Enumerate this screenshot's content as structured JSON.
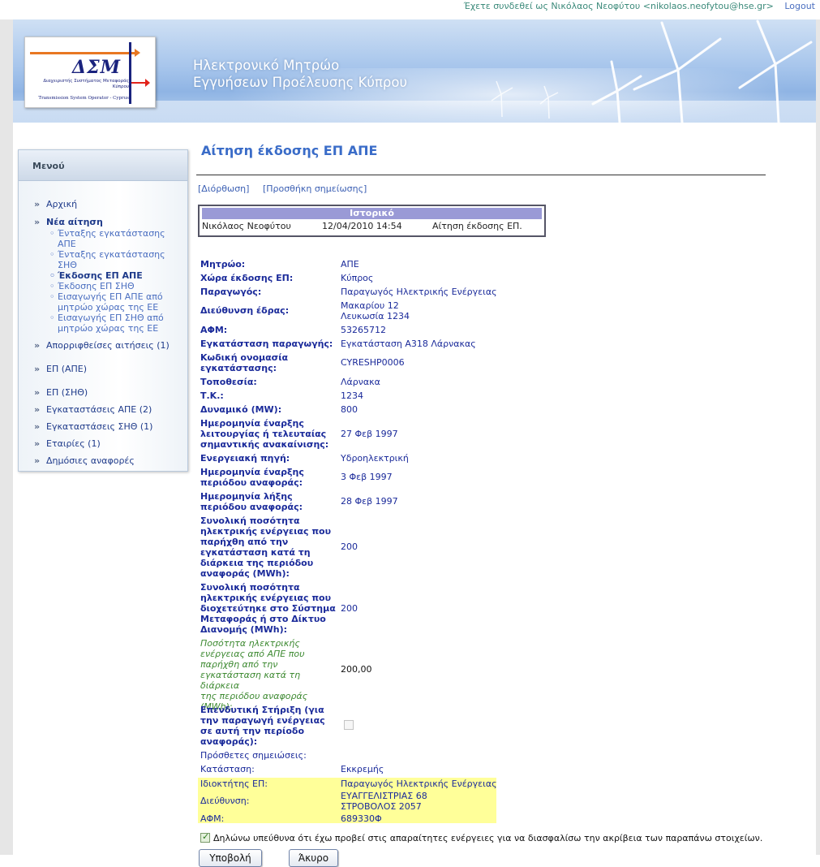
{
  "topbar": {
    "login_text": "Έχετε συνδεθεί ως Νικόλαος Νεοφύτου <nikolaos.neofytou@hse.gr>",
    "logout_label": "Logout"
  },
  "header": {
    "logo_mark": "ΔΣΜ",
    "logo_sub1": "Διαχειριστής Συστήματος Μεταφοράς Κύπρου",
    "logo_sub2": "Transmission System Operator - Cyprus",
    "title_line1": "Ηλεκτρονικό Μητρώο",
    "title_line2": "Εγγυήσεων Προέλευσης Κύπρου"
  },
  "sidebar": {
    "title": "Μενού",
    "items": [
      {
        "label": "Αρχική"
      },
      {
        "label": "Νέα αίτηση"
      },
      {
        "label": "Απορριφθείσες αιτήσεις (1)"
      },
      {
        "label": "ΕΠ (ΑΠΕ)"
      },
      {
        "label": "ΕΠ (ΣΗΘ)"
      },
      {
        "label": "Εγκαταστάσεις ΑΠΕ (2)"
      },
      {
        "label": "Εγκαταστάσεις ΣΗΘ (1)"
      },
      {
        "label": "Εταιρίες (1)"
      },
      {
        "label": "Δημόσιες αναφορές"
      }
    ],
    "subitems": [
      {
        "label_l1": "Ένταξης εγκατάστασης",
        "label_l2": "ΑΠΕ"
      },
      {
        "label_l1": "Ένταξης εγκατάστασης",
        "label_l2": "ΣΗΘ"
      },
      {
        "label_l1": "Έκδοσης ΕΠ ΑΠΕ"
      },
      {
        "label_l1": "Έκδοσης ΕΠ ΣΗΘ"
      },
      {
        "label_l1": "Εισαγωγής ΕΠ ΑΠΕ από",
        "label_l2": "μητρώο χώρας της ΕΕ"
      },
      {
        "label_l1": "Εισαγωγής ΕΠ ΣΗΘ από",
        "label_l2": "μητρώο χώρας της ΕΕ"
      }
    ]
  },
  "main": {
    "page_title": "Αίτηση έκδοσης ΕΠ ΑΠΕ",
    "actions": {
      "edit": "[Διόρθωση]",
      "add_note": "[Προσθήκη σημείωσης]"
    },
    "history": {
      "title": "Ιστορικό",
      "user": "Νικόλαος Νεοφύτου",
      "datetime": "12/04/2010 14:54",
      "action": "Αίτηση έκδοσης ΕΠ."
    },
    "fields": {
      "registry": {
        "label": "Μητρώο:",
        "value": "ΑΠΕ"
      },
      "country": {
        "label": "Χώρα έκδοσης ΕΠ:",
        "value": "Κύπρος"
      },
      "producer": {
        "label": "Παραγωγός:",
        "value": "Παραγωγός Ηλεκτρικής Ενέργειας"
      },
      "address": {
        "label": "Διεύθυνση έδρας:",
        "value_l1": "Μακαρίου 12",
        "value_l2": "Λευκωσία 1234"
      },
      "afm": {
        "label": "ΑΦΜ:",
        "value": "53265712"
      },
      "installation": {
        "label": "Εγκατάσταση παραγωγής:",
        "value": "Εγκατάσταση Α318 Λάρνακας"
      },
      "code": {
        "label_l1": "Κωδική ονομασία",
        "label_l2": "εγκατάστασης:",
        "value": "CYRESHP0006"
      },
      "location": {
        "label": "Τοποθεσία:",
        "value": "Λάρνακα"
      },
      "postcode": {
        "label": "Τ.Κ.:",
        "value": "1234"
      },
      "capacity": {
        "label": "Δυναμικό (MW):",
        "value": "800"
      },
      "start_date": {
        "label_l1": "Ημερομηνία έναρξης",
        "label_l2": "λειτουργίας ή τελευταίας",
        "label_l3": "σημαντικής ανακαίνισης:",
        "value": "27 Φεβ 1997"
      },
      "energy_source": {
        "label": "Ενεργειακή πηγή:",
        "value": "Υδροηλεκτρική"
      },
      "period_start": {
        "label_l1": "Ημερομηνία έναρξης",
        "label_l2": "περιόδου αναφοράς:",
        "value": "3 Φεβ 1997"
      },
      "period_end": {
        "label_l1": "Ημερομηνία λήξης",
        "label_l2": "περιόδου αναφοράς:",
        "value": "28 Φεβ 1997"
      },
      "total_produced": {
        "label_l1": "Συνολική ποσότητα",
        "label_l2": "ηλεκτρικής ενέργειας που",
        "label_l3": "παρήχθη από την",
        "label_l4": "εγκατάσταση κατά τη",
        "label_l5": "διάρκεια της περιόδου",
        "label_l6": "αναφοράς (MWh):",
        "value": "200"
      },
      "total_injected": {
        "label_l1": "Συνολική ποσότητα",
        "label_l2": "ηλεκτρικής ενέργειας που",
        "label_l3": "διοχετεύτηκε στο Σύστημα",
        "label_l4": "Μεταφοράς ή στο Δίκτυο",
        "label_l5": "Διανομής (MWh):",
        "value": "200"
      },
      "res_quantity": {
        "label_l1": "Ποσότητα ηλεκτρικής",
        "label_l2": "ενέργειας από ΑΠΕ που",
        "label_l3": "παρήχθη από την",
        "label_l4": "εγκατάσταση κατά τη διάρκεια",
        "label_l5": "της περιόδου αναφοράς",
        "label_l6": "(MWh):",
        "value": "200,00"
      },
      "investment_support": {
        "label_l1": "Επενδυτική Στήριξη (για",
        "label_l2": "την παραγωγή ενέργειας",
        "label_l3": "σε αυτή την περίοδο",
        "label_l4": "αναφοράς):"
      },
      "notes": {
        "label": "Πρόσθετες σημειώσεις:"
      },
      "status": {
        "label": "Κατάσταση:",
        "value": "Εκκρεμής"
      },
      "owner": {
        "label": "Ιδιοκτήτης ΕΠ:",
        "value": "Παραγωγός Ηλεκτρικής Ενέργειας"
      },
      "owner_address": {
        "label": "Διεύθυνση:",
        "value_l1": "ΕΥΑΓΓΕΛΙΣΤΡΙΑΣ 68",
        "value_l2": "ΣΤΡΟΒΟΛΟΣ 2057"
      },
      "owner_afm": {
        "label": "ΑΦΜ:",
        "value": "689330Φ"
      }
    },
    "declaration": "Δηλώνω υπεύθυνα ότι έχω προβεί στις απαραίτητες ενέργειες για να διασφαλίσω την ακρίβεια των παραπάνω στοιχείων.",
    "declaration_checked": true,
    "submit_label": "Υποβολή",
    "cancel_label": "Άκυρο"
  }
}
